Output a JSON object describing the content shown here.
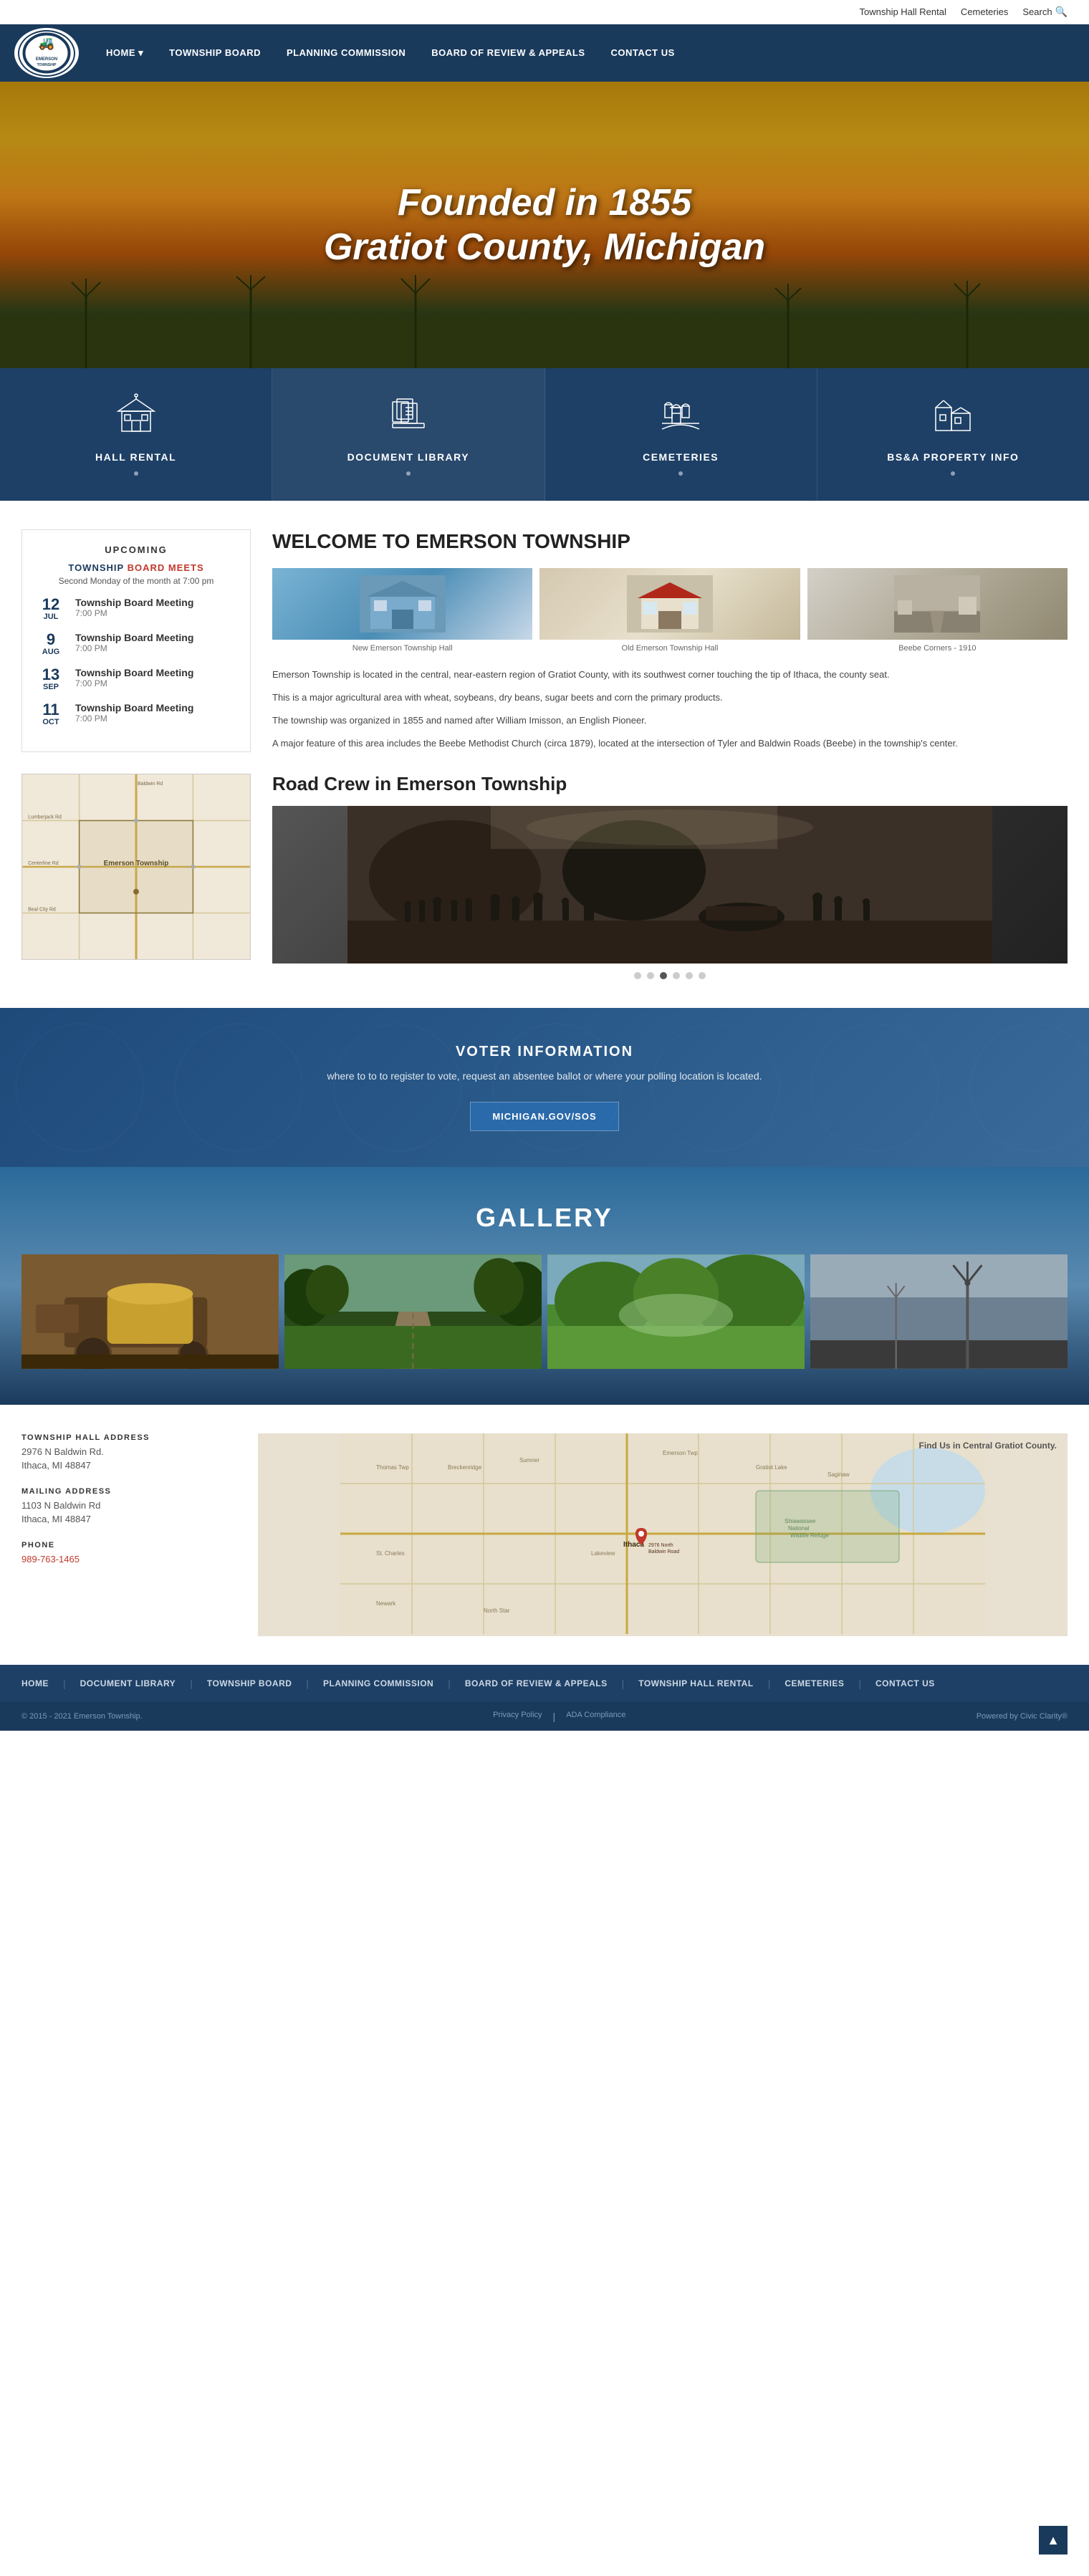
{
  "site": {
    "name": "Emerson Township",
    "tagline": "Founded in 1855\nGratiot County, Michigan"
  },
  "topbar": {
    "links": [
      {
        "label": "Township Hall Rental",
        "href": "#"
      },
      {
        "label": "Cemeteries",
        "href": "#"
      },
      {
        "label": "Search",
        "href": "#"
      }
    ]
  },
  "nav": {
    "items": [
      {
        "label": "HOME",
        "href": "#",
        "dropdown": true
      },
      {
        "label": "TOWNSHIP BOARD",
        "href": "#",
        "dropdown": false
      },
      {
        "label": "PLANNING COMMISSION",
        "href": "#",
        "dropdown": false
      },
      {
        "label": "BOARD OF REVIEW & APPEALS",
        "href": "#",
        "dropdown": false
      },
      {
        "label": "CONTACT US",
        "href": "#",
        "dropdown": false
      }
    ]
  },
  "hero": {
    "line1": "Founded in 1855",
    "line2": "Gratiot County, Michigan"
  },
  "tiles": [
    {
      "label": "HALL RENTAL",
      "icon": "hall-icon"
    },
    {
      "label": "DOCUMENT LIBRARY",
      "icon": "library-icon"
    },
    {
      "label": "CEMETERIES",
      "icon": "cemetery-icon"
    },
    {
      "label": "BS&A PROPERTY INFO",
      "icon": "property-icon"
    }
  ],
  "upcoming": {
    "title": "UPCOMING",
    "board_label": "TOWNSHIP BOARD MEETS",
    "township_part": "TOWNSHIP",
    "board_part": "BOARD MEETS",
    "schedule": "Second Monday of the month at 7:00 pm",
    "meetings": [
      {
        "day": "12",
        "month": "JUL",
        "name": "Township Board Meeting",
        "time": "7:00 PM"
      },
      {
        "day": "9",
        "month": "AUG",
        "name": "Township Board Meeting",
        "time": "7:00 PM"
      },
      {
        "day": "13",
        "month": "SEP",
        "name": "Township Board Meeting",
        "time": "7:00 PM"
      },
      {
        "day": "11",
        "month": "OCT",
        "name": "Township Board Meeting",
        "time": "7:00 PM"
      }
    ]
  },
  "welcome": {
    "title": "WELCOME TO EMERSON TOWNSHIP",
    "photos": [
      {
        "caption": "New Emerson Township Hall"
      },
      {
        "caption": "Old Emerson Township Hall"
      },
      {
        "caption": "Beebe Corners - 1910"
      }
    ],
    "paragraphs": [
      "Emerson Township is located in the central, near-eastern region of Gratiot County, with its southwest corner touching the tip of Ithaca, the county seat.",
      "This is a major agricultural area with wheat, soybeans, dry beans, sugar beets and corn the primary products.",
      "The township was organized in 1855 and named after William Imisson, an English Pioneer.",
      "A major feature of this area includes the Beebe Methodist Church (circa 1879), located at the intersection of Tyler and Baldwin Roads (Beebe) in the township's center."
    ]
  },
  "road_crew": {
    "title": "Road Crew in Emerson Township",
    "dots": [
      1,
      2,
      3,
      4,
      5,
      6
    ],
    "active_dot": 3
  },
  "voter": {
    "title": "VOTER INFORMATION",
    "subtitle": "where to to to register to vote, request an absentee ballot\nor where your polling location is located.",
    "button_label": "MICHIGAN.GOV/SOS"
  },
  "gallery": {
    "title": "GALLERY",
    "images": [
      {
        "label": "Farm Equipment"
      },
      {
        "label": "Country Road"
      },
      {
        "label": "Green Field"
      },
      {
        "label": "Wind Turbine"
      }
    ]
  },
  "footer": {
    "address_label": "TOWNSHIP HALL ADDRESS",
    "address": "2976 N Baldwin Rd.\nIthaca, MI 48847",
    "mailing_label": "MAILING ADDRESS",
    "mailing": "1103 N Baldwin Rd\nIthaca, MI 48847",
    "phone_label": "PHONE",
    "phone": "989-763-1465",
    "map_title": "Find Us in Central Gratiot County."
  },
  "bottom_nav": {
    "items": [
      {
        "label": "HOME"
      },
      {
        "label": "DOCUMENT LIBRARY"
      },
      {
        "label": "TOWNSHIP BOARD"
      },
      {
        "label": "PLANNING COMMISSION"
      },
      {
        "label": "BOARD OF REVIEW & APPEALS"
      },
      {
        "label": "TOWNSHIP HALL RENTAL"
      },
      {
        "label": "CEMETERIES"
      },
      {
        "label": "CONTACT US"
      }
    ]
  },
  "very_bottom": {
    "copyright": "© 2015 - 2021 Emerson Township.",
    "privacy_label": "Privacy Policy",
    "ada_label": "ADA Compliance",
    "powered_label": "Powered by Civic Clarity®"
  }
}
